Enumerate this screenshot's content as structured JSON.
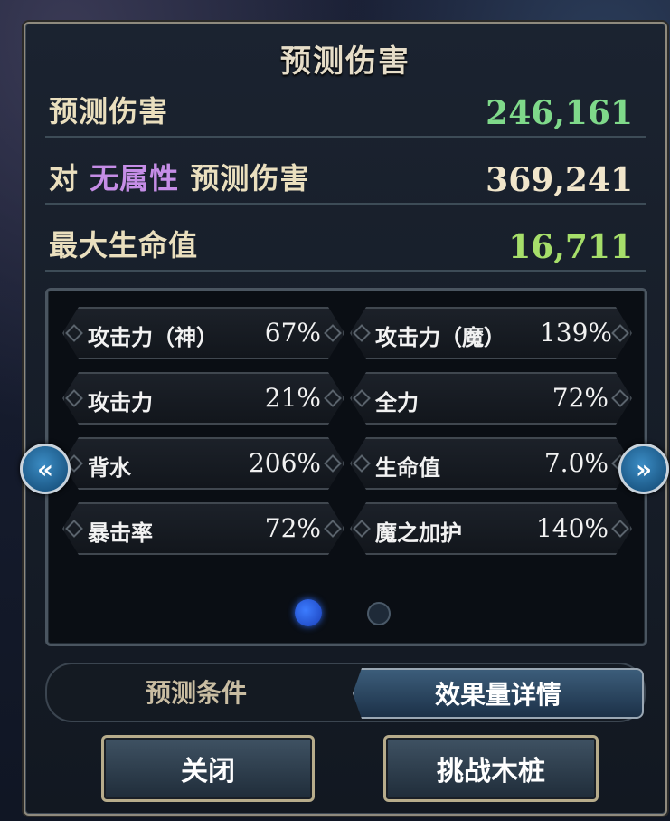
{
  "dialog": {
    "title": "预测伤害",
    "rows": [
      {
        "label": "预测伤害",
        "value": "246,161"
      },
      {
        "label_prefix": "对",
        "label_attr": "无属性",
        "label_suffix": "预测伤害",
        "value": "369,241"
      },
      {
        "label": "最大生命值",
        "value": "16,711"
      }
    ],
    "stats": [
      {
        "label": "攻击力（神）",
        "value": "67%"
      },
      {
        "label": "攻击力（魔）",
        "value": "139%"
      },
      {
        "label": "攻击力",
        "value": "21%"
      },
      {
        "label": "全力",
        "value": "72%"
      },
      {
        "label": "背水",
        "value": "206%"
      },
      {
        "label": "生命值",
        "value": "7.0%"
      },
      {
        "label": "暴击率",
        "value": "72%"
      },
      {
        "label": "魔之加护",
        "value": "140%"
      }
    ],
    "nav": {
      "left_icon": "«",
      "right_icon": "»"
    },
    "tabs": {
      "left": "预测条件",
      "right": "效果量详情",
      "active": "right"
    },
    "buttons": {
      "close": "关闭",
      "challenge": "挑战木桩"
    },
    "colors": {
      "damage_value": "#7fd98a",
      "attr_highlight": "#c58de6",
      "hp_value": "#a6de6a",
      "pager_active": "#2b64e8"
    },
    "pager": {
      "current": 1,
      "total": 2
    }
  }
}
